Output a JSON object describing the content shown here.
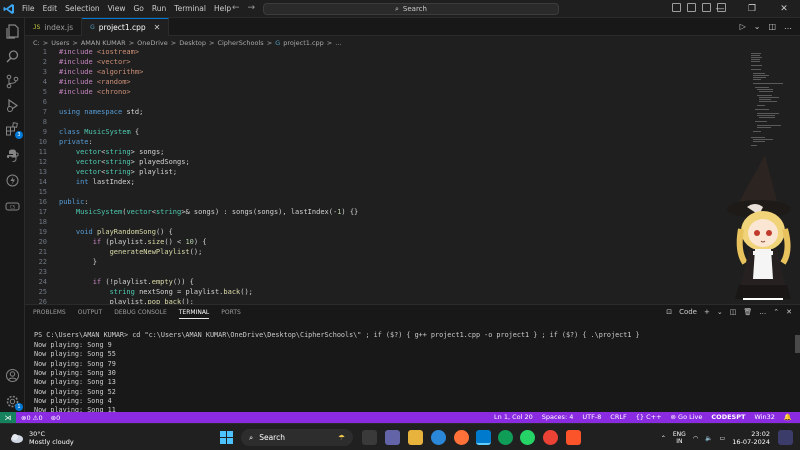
{
  "menu": [
    "File",
    "Edit",
    "Selection",
    "View",
    "Go",
    "Run",
    "Terminal",
    "Help"
  ],
  "search": {
    "label": "Search"
  },
  "tabs": [
    {
      "label": "index.js",
      "active": false
    },
    {
      "label": "project1.cpp",
      "active": true
    }
  ],
  "breadcrumb": [
    "C:",
    ">",
    "Users",
    ">",
    "AMAN KUMAR",
    ">",
    "OneDrive",
    ">",
    "Desktop",
    ">",
    "CipherSchools",
    ">",
    "project1.cpp",
    ">",
    "..."
  ],
  "code_lines": [
    {
      "n": "1",
      "text": "#include <iostream>"
    },
    {
      "n": "2",
      "text": "#include <vector>"
    },
    {
      "n": "3",
      "text": "#include <algorithm>"
    },
    {
      "n": "4",
      "text": "#include <random>"
    },
    {
      "n": "5",
      "text": "#include <chrono>"
    },
    {
      "n": "6",
      "text": ""
    },
    {
      "n": "7",
      "text": "using namespace std;"
    },
    {
      "n": "8",
      "text": ""
    },
    {
      "n": "9",
      "text": "class MusicSystem {"
    },
    {
      "n": "10",
      "text": "private:"
    },
    {
      "n": "11",
      "text": "    vector<string> songs;"
    },
    {
      "n": "12",
      "text": "    vector<string> playedSongs;"
    },
    {
      "n": "13",
      "text": "    vector<string> playlist;"
    },
    {
      "n": "14",
      "text": "    int lastIndex;"
    },
    {
      "n": "15",
      "text": ""
    },
    {
      "n": "16",
      "text": "public:"
    },
    {
      "n": "17",
      "text": "    MusicSystem(vector<string>& songs) : songs(songs), lastIndex(-1) {}"
    },
    {
      "n": "18",
      "text": ""
    },
    {
      "n": "19",
      "text": "    void playRandomSong() {"
    },
    {
      "n": "20",
      "text": "        if (playlist.size() < 10) {"
    },
    {
      "n": "21",
      "text": "            generateNewPlaylist();"
    },
    {
      "n": "22",
      "text": "        }"
    },
    {
      "n": "23",
      "text": ""
    },
    {
      "n": "24",
      "text": "        if (!playlist.empty()) {"
    },
    {
      "n": "25",
      "text": "            string nextSong = playlist.back();"
    },
    {
      "n": "26",
      "text": "            playlist.pop_back();"
    }
  ],
  "panel_tabs": [
    "PROBLEMS",
    "OUTPUT",
    "DEBUG CONSOLE",
    "TERMINAL",
    "PORTS"
  ],
  "panel_actions": {
    "shell": "Code"
  },
  "terminal": {
    "command": "PS C:\\Users\\AMAN KUMAR> cd \"c:\\Users\\AMAN KUMAR\\OneDrive\\Desktop\\CipherSchools\\\" ; if ($?) { g++ project1.cpp -o project1 } ; if ($?) { .\\project1 }",
    "output": [
      "Now playing: Song 9",
      "Now playing: Song 55",
      "Now playing: Song 79",
      "Now playing: Song 30",
      "Now playing: Song 13",
      "Now playing: Song 52",
      "Now playing: Song 4",
      "Now playing: Song 11"
    ]
  },
  "status": {
    "errors": "0",
    "warnings": "0",
    "ports": "0",
    "cursor": "Ln 1, Col 20",
    "spaces": "Spaces: 4",
    "encoding": "UTF-8",
    "eol": "CRLF",
    "language": "C++",
    "golive": "Go Live",
    "codesnap": "CODESPT",
    "platform": "Win32"
  },
  "taskbar": {
    "weather_temp": "30°C",
    "weather_desc": "Mostly cloudy",
    "search_label": "Search",
    "lang_top": "ENG",
    "lang_bottom": "IN",
    "time": "23:02",
    "date": "16-07-2024"
  },
  "colors": {
    "keyword": "#569cd6",
    "type": "#4ec9b0",
    "function": "#dcdcaa",
    "string": "#ce9178",
    "number": "#b5cea8",
    "variable": "#9cdcfe",
    "control": "#c586c0",
    "statusbar": "#8a2be2"
  }
}
